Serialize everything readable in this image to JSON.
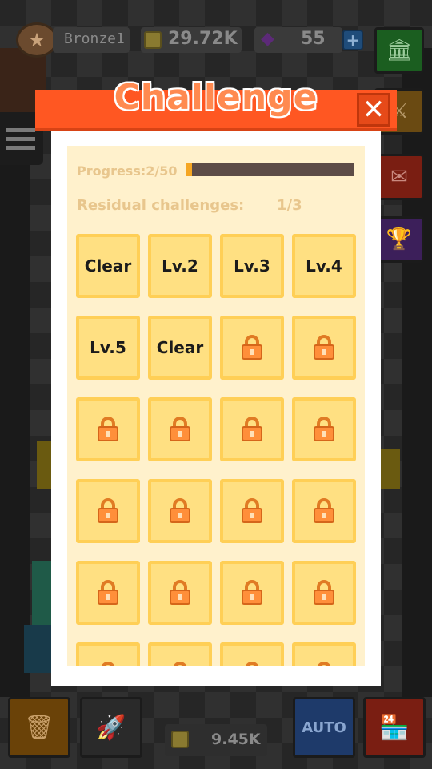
{
  "hud": {
    "rank": {
      "label": "Bronze1"
    },
    "gold": {
      "value": "29.72K"
    },
    "gems": {
      "value": "55",
      "plus_label": "+"
    },
    "side_buttons": [
      {
        "name": "bank-icon"
      },
      {
        "name": "sword-icon"
      },
      {
        "name": "mail-icon"
      },
      {
        "name": "trophy-icon"
      }
    ]
  },
  "bottom_bar": {
    "auto_label": "AUTO",
    "income": {
      "value": "9.45K"
    }
  },
  "modal": {
    "title": "Challenge",
    "close_label": "✕",
    "progress": {
      "label": "Progress:2/50",
      "current": 2,
      "total": 50
    },
    "residual": {
      "label": "Residual challenges:",
      "value": "1/3"
    },
    "cells": [
      {
        "label": "Clear",
        "locked": false
      },
      {
        "label": "Lv.2",
        "locked": false
      },
      {
        "label": "Lv.3",
        "locked": false
      },
      {
        "label": "Lv.4",
        "locked": false
      },
      {
        "label": "Lv.5",
        "locked": false
      },
      {
        "label": "Clear",
        "locked": false
      },
      {
        "label": "",
        "locked": true
      },
      {
        "label": "",
        "locked": true
      },
      {
        "label": "",
        "locked": true
      },
      {
        "label": "",
        "locked": true
      },
      {
        "label": "",
        "locked": true
      },
      {
        "label": "",
        "locked": true
      },
      {
        "label": "",
        "locked": true
      },
      {
        "label": "",
        "locked": true
      },
      {
        "label": "",
        "locked": true
      },
      {
        "label": "",
        "locked": true
      },
      {
        "label": "",
        "locked": true
      },
      {
        "label": "",
        "locked": true
      },
      {
        "label": "",
        "locked": true
      },
      {
        "label": "",
        "locked": true
      },
      {
        "label": "",
        "locked": true
      },
      {
        "label": "",
        "locked": true
      },
      {
        "label": "",
        "locked": true
      },
      {
        "label": "",
        "locked": true
      }
    ]
  },
  "colors": {
    "header": "#ff5722",
    "panel": "#fff1cc",
    "cell_fill": "#ffe082",
    "cell_border": "#ffcf56",
    "progress_fill": "#f5a623",
    "progress_track": "#5d4c47",
    "lock": "#ff8f3a"
  }
}
